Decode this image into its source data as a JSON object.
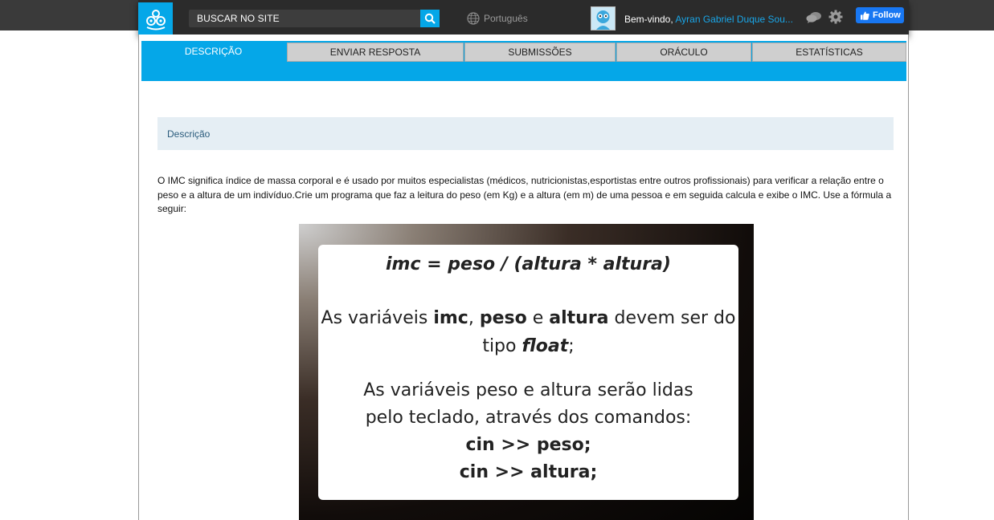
{
  "header": {
    "search_placeholder": "BUSCAR NO SITE",
    "language": "Português",
    "welcome": "Bem-vindo,",
    "user_name": "Ayran Gabriel Duque Sou...",
    "follow_label": "Follow"
  },
  "tabs": [
    {
      "label": "DESCRIÇÃO",
      "active": true
    },
    {
      "label": "ENVIAR RESPOSTA",
      "active": false
    },
    {
      "label": "SUBMISSÕES",
      "active": false
    },
    {
      "label": "ORÁCULO",
      "active": false
    },
    {
      "label": "ESTATÍSTICAS",
      "active": false
    }
  ],
  "section": {
    "title": "Descrição",
    "text": "O IMC significa índice de massa corporal e é usado por muitos especialistas (médicos, nutricionistas,esportistas entre outros profissionais) para verificar a relação entre o peso e a altura de um indivíduo.Crie um programa que faz a leitura do peso (em Kg) e a altura (em m) de uma pessoa e em seguida calcula e exibe o IMC. Use a fórmula a seguir:"
  },
  "image": {
    "formula": "imc = peso / (altura * altura)",
    "line2_a": "As variáveis ",
    "line2_imc": "imc",
    "line2_b": ", ",
    "line2_peso": "peso",
    "line2_c": " e ",
    "line2_altura": "altura",
    "line2_d": " devem ser do tipo ",
    "line2_float": "float",
    "line2_e": ";",
    "line3": "As variáveis peso e altura serão lidas pelo teclado, através dos comandos:",
    "cmd1": "cin >> peso;",
    "cmd2": "cin >> altura;"
  },
  "colors": {
    "accent": "#05a7e8",
    "header_bg": "#2b2b2b",
    "desc_box_bg": "#e5eef4"
  }
}
